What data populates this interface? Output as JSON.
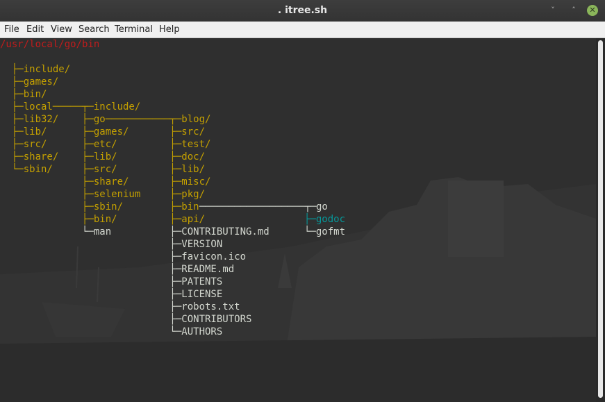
{
  "window": {
    "title": ". itree.sh",
    "minimize_glyph": "˅",
    "maximize_glyph": "˄",
    "close_glyph": "✕"
  },
  "menu": [
    "File",
    "Edit",
    "View",
    "Search",
    "Terminal",
    "Help"
  ],
  "colors": {
    "path": "#c01c1c",
    "directory": "#c4a000",
    "file": "#d3d7cf",
    "highlight": "#06989a"
  },
  "terminal": {
    "prompt_path": "/usr/local/go/bin",
    "lines": [
      {
        "text": "",
        "color": "file"
      },
      {
        "text": "  ├─include/",
        "color": "directory"
      },
      {
        "text": "  ├─games/",
        "color": "directory"
      },
      {
        "text": "  ├─bin/",
        "color": "directory"
      },
      {
        "text": "  ├─local─────┬─include/",
        "color": "directory"
      },
      {
        "text": "  ├─lib32/    ├─go───────────┬─blog/",
        "color": "directory"
      },
      {
        "text": "  ├─lib/      ├─games/       ├─src/",
        "color": "directory"
      },
      {
        "text": "  ├─src/      ├─etc/         ├─test/",
        "color": "directory"
      },
      {
        "text": "  ├─share/    ├─lib/         ├─doc/",
        "color": "directory"
      },
      {
        "text": "  └─sbin/     ├─src/         ├─lib/",
        "color": "directory"
      },
      {
        "text": "              ├─share/       ├─misc/",
        "color": "directory"
      },
      {
        "text": "              ├─selenium     ├─pkg/",
        "color": "directory"
      },
      {
        "text": "              ├─sbin/        ├─bin",
        "color": "directory"
      },
      {
        "text": "              ├─bin/         ├─api/",
        "color": "directory"
      },
      {
        "text": "              └─man          ├─CONTRIBUTING.md",
        "color": "file"
      },
      {
        "text": "                             ├─VERSION",
        "color": "file"
      },
      {
        "text": "                             ├─favicon.ico",
        "color": "file"
      },
      {
        "text": "                             ├─README.md",
        "color": "file"
      },
      {
        "text": "                             ├─PATENTS",
        "color": "file"
      },
      {
        "text": "                             ├─LICENSE",
        "color": "file"
      },
      {
        "text": "                             ├─robots.txt",
        "color": "file"
      },
      {
        "text": "                             ├─CONTRIBUTORS",
        "color": "file"
      },
      {
        "text": "                             └─AUTHORS",
        "color": "file"
      }
    ],
    "bin_branch": {
      "connector": "──────────────────┬─",
      "items": [
        {
          "text": "go",
          "color": "file"
        },
        {
          "text": "├─godoc",
          "color": "highlight"
        },
        {
          "text": "└─gofmt",
          "color": "file"
        }
      ]
    }
  }
}
